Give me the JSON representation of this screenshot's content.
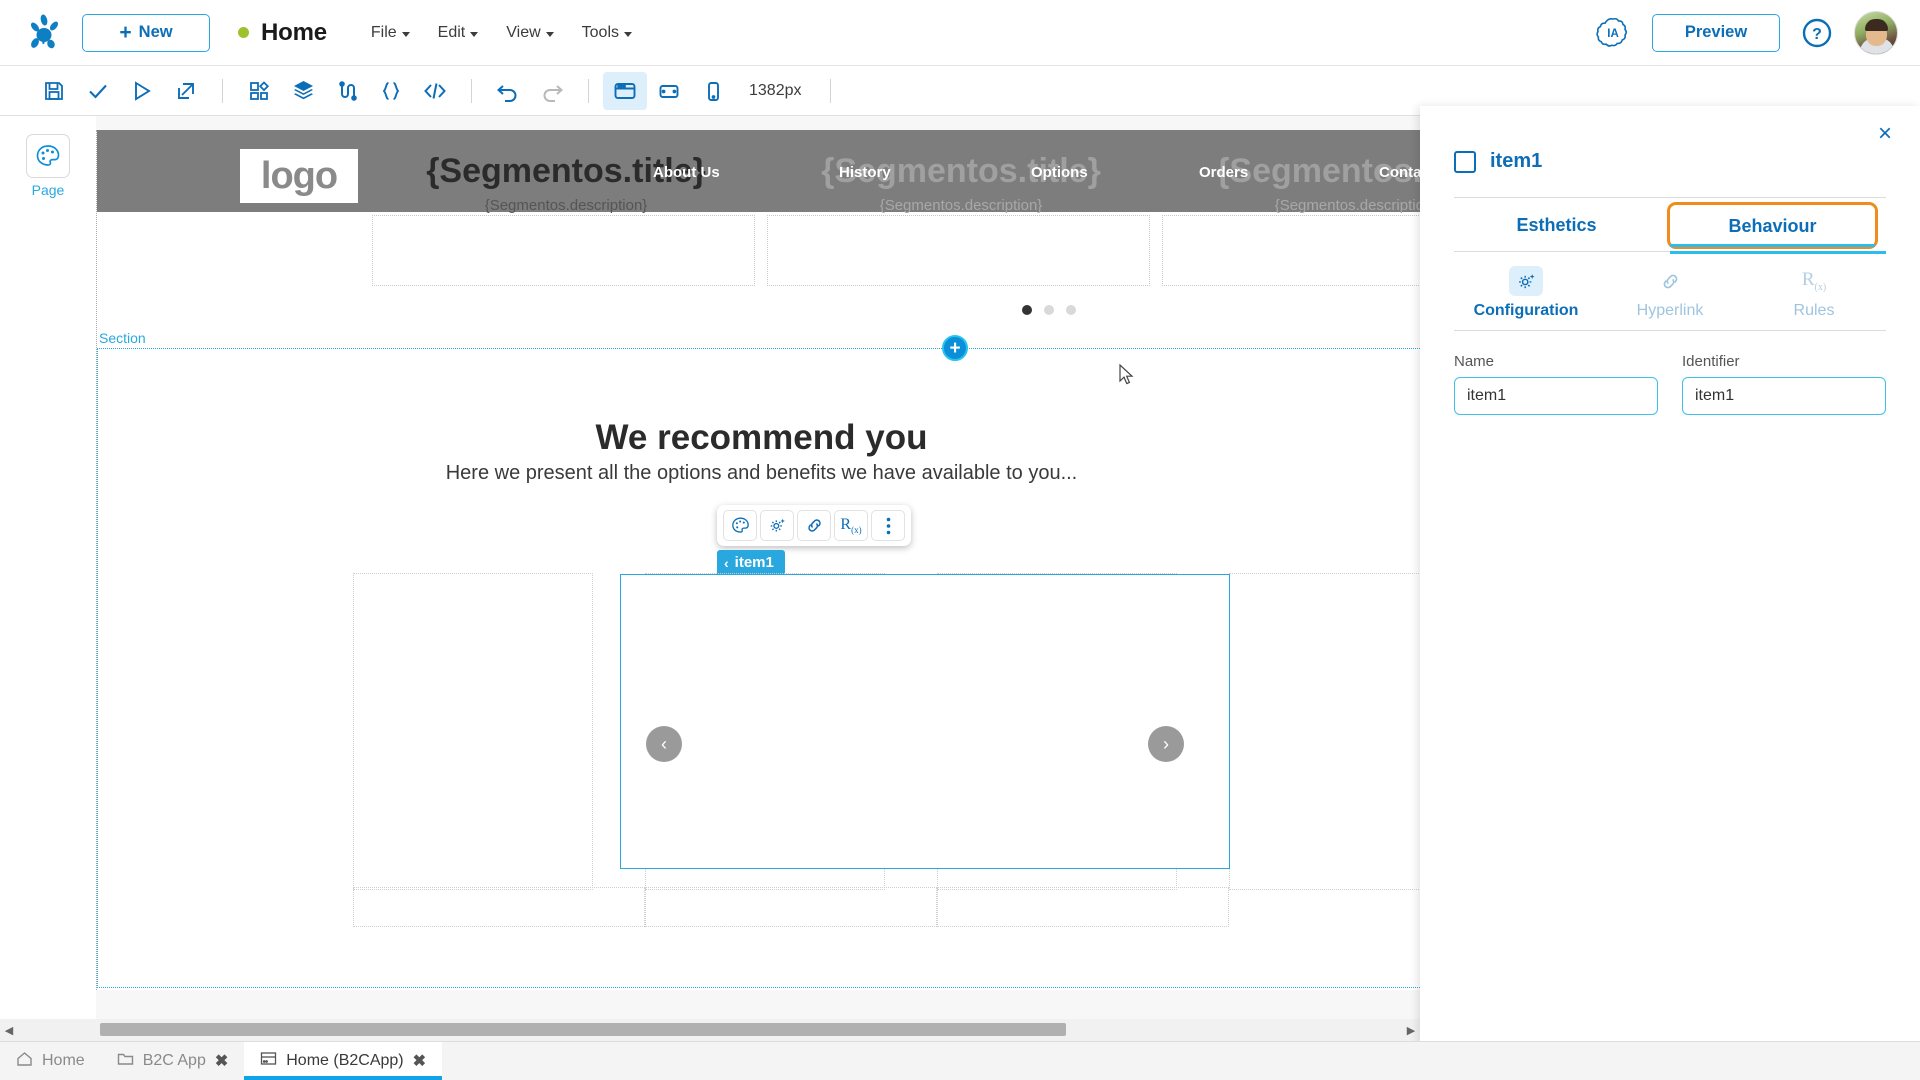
{
  "topbar": {
    "new_label": "New",
    "page_title": "Home",
    "menus": [
      "File",
      "Edit",
      "View",
      "Tools"
    ],
    "ia_label": "IA",
    "preview_label": "Preview"
  },
  "toolbar": {
    "zoom_label": "1382px",
    "icons": [
      {
        "name": "save-icon",
        "glyph": "save"
      },
      {
        "name": "validate-check-icon",
        "glyph": "check"
      },
      {
        "name": "run-play-icon",
        "glyph": "play"
      },
      {
        "name": "deploy-export-icon",
        "glyph": "export"
      },
      {
        "name": "components-icon",
        "glyph": "components"
      },
      {
        "name": "layers-icon",
        "glyph": "layers"
      },
      {
        "name": "flow-icon",
        "glyph": "flow"
      },
      {
        "name": "braces-icon",
        "glyph": "braces"
      },
      {
        "name": "code-icon",
        "glyph": "code"
      },
      {
        "name": "undo-icon",
        "glyph": "undo"
      },
      {
        "name": "redo-icon",
        "glyph": "redo"
      },
      {
        "name": "desktop-view-icon",
        "glyph": "desktop"
      },
      {
        "name": "tablet-view-icon",
        "glyph": "tablet"
      },
      {
        "name": "mobile-view-icon",
        "glyph": "mobile"
      }
    ]
  },
  "leftrail": {
    "page_label": "Page"
  },
  "canvas": {
    "logo_text": "logo",
    "nav_links": [
      "About Us",
      "History",
      "Options",
      "Orders",
      "Contact"
    ],
    "segments": [
      {
        "title": "{Segmentos.title}",
        "description": "{Segmentos.description}"
      },
      {
        "title": "{Segmentos.title}",
        "description": "{Segmentos.description}"
      },
      {
        "title": "{Segmentos.title}",
        "description": "{Segmentos.description}"
      }
    ],
    "carousel_dots": 3,
    "carousel_active_dot": 0,
    "section_label": "Section",
    "headline": "We recommend you",
    "subheadline": "Here we present all the options and benefits we have available to you...",
    "element_badge": "item1",
    "prev_arrow": "‹",
    "next_arrow": "›",
    "float_toolbar": [
      {
        "name": "palette-icon",
        "glyph": "palette"
      },
      {
        "name": "gear-sparkle-icon",
        "glyph": "gear"
      },
      {
        "name": "link-icon",
        "glyph": "link"
      },
      {
        "name": "rules-rx-icon",
        "glyph": "rx"
      },
      {
        "name": "more-options-icon",
        "glyph": "kebab"
      }
    ]
  },
  "rightpanel": {
    "close_label": "×",
    "element_name": "item1",
    "tabs": [
      {
        "label": "Esthetics",
        "state": "normal"
      },
      {
        "label": "Behaviour",
        "state": "selected-highlighted"
      }
    ],
    "subtabs": [
      {
        "label": "Configuration",
        "icon": "gear-sparkle-icon",
        "state": "active"
      },
      {
        "label": "Hyperlink",
        "icon": "link-icon",
        "state": "dim"
      },
      {
        "label": "Rules",
        "icon": "rules-rx-icon",
        "state": "dim"
      }
    ],
    "fields": [
      {
        "label": "Name",
        "value": "item1",
        "placeholder": "Name"
      },
      {
        "label": "Identifier",
        "value": "item1",
        "placeholder": "Identifier"
      }
    ]
  },
  "bottomtabs": [
    {
      "label": "Home",
      "icon": "home-icon",
      "closable": false,
      "active": false
    },
    {
      "label": "B2C App",
      "icon": "folder-icon",
      "closable": true,
      "active": false
    },
    {
      "label": "Home (B2CApp)",
      "icon": "window-icon",
      "closable": true,
      "active": true
    }
  ],
  "colors": {
    "accent_blue": "#0d6eb8",
    "light_blue": "#29a8e0",
    "highlight_orange": "#f08c1b",
    "status_green": "#9ec32a"
  }
}
